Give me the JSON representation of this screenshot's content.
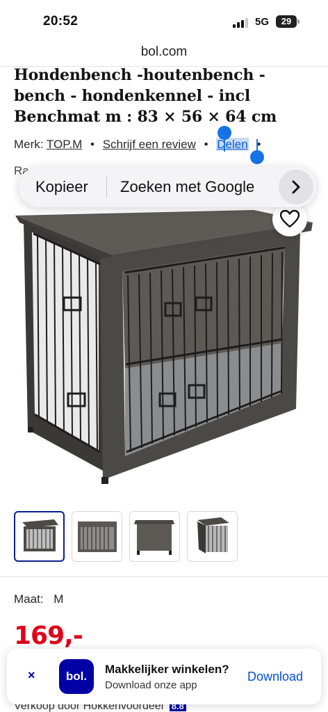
{
  "status_bar": {
    "time": "20:52",
    "network": "5G",
    "battery": "29"
  },
  "url_bar": {
    "domain": "bol.com"
  },
  "product": {
    "title_line1": "Hondenbench -houtenbench -",
    "title_line2": "bench - hondenkennel - incl",
    "title_line3": "Benchmat m : 83 × 56 × 64 cm",
    "brand_label": "Merk:",
    "brand_value": "TOP.M",
    "review_link": "Schrijf een review",
    "share_link": "Delen",
    "separator": "•",
    "peek_text": "Ra"
  },
  "context_menu": {
    "copy_label": "Kopieer",
    "search_label": "Zoeken met Google"
  },
  "size": {
    "label": "Maat:",
    "value": "M"
  },
  "price": {
    "value": "169,-"
  },
  "seller": {
    "text": "Verkoop door Hokkenvoordeel",
    "score": "8.8"
  },
  "app_banner": {
    "close_icon": "×",
    "logo_text": "bol.",
    "title": "Makkelijker winkelen?",
    "subtitle": "Download onze app",
    "download_label": "Download"
  },
  "colors": {
    "price_red": "#e0001b",
    "brand_blue": "#0000a4",
    "selection_blue": "#1673e6"
  },
  "icons": [
    "heart-icon",
    "chevron-right-icon",
    "close-icon"
  ]
}
